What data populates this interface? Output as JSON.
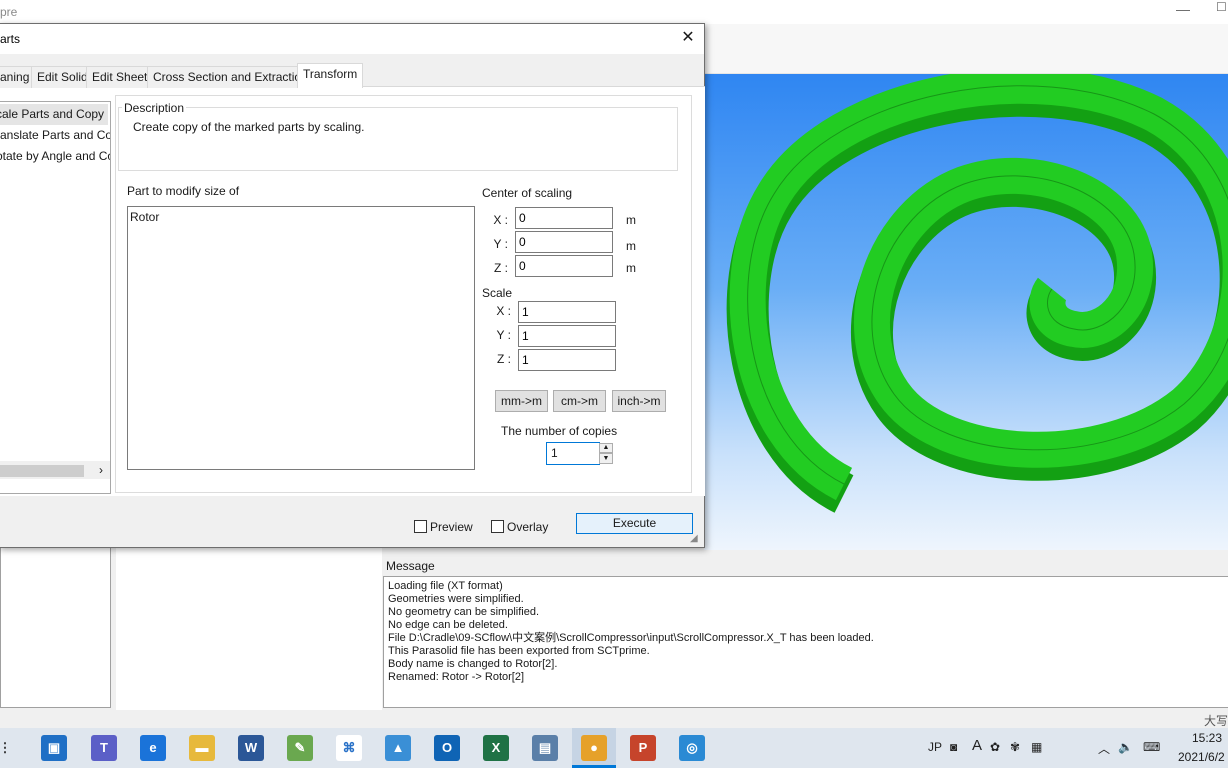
{
  "app": {
    "title": "pre",
    "status_text": "大写"
  },
  "dialog": {
    "title": "arts",
    "tabs": [
      {
        "label": "aning"
      },
      {
        "label": "Edit Solid"
      },
      {
        "label": "Edit Sheet"
      },
      {
        "label": "Cross Section and Extraction"
      },
      {
        "label": "Transform"
      }
    ],
    "active_tab": "Transform",
    "menu_items": [
      {
        "label": "cale Parts and Copy"
      },
      {
        "label": "ranslate Parts and Cop"
      },
      {
        "label": "otate by Angle and Co"
      }
    ],
    "description": {
      "legend": "Description",
      "text": "Create copy of the marked parts by scaling."
    },
    "parts": {
      "label": "Part to modify size of",
      "items": [
        "Rotor"
      ]
    },
    "center": {
      "label": "Center of scaling",
      "x_label": "X :",
      "y_label": "Y :",
      "z_label": "Z :",
      "x": "0",
      "y": "0",
      "z": "0",
      "unit": "m"
    },
    "scale": {
      "label": "Scale",
      "x_label": "X :",
      "y_label": "Y :",
      "z_label": "Z :",
      "x": "1",
      "y": "1",
      "z": "1"
    },
    "conversion_buttons": [
      "mm->m",
      "cm->m",
      "inch->m"
    ],
    "copies": {
      "label": "The number of copies",
      "value": "1"
    },
    "preview_label": "Preview",
    "overlay_label": "Overlay",
    "execute_label": "Execute"
  },
  "message": {
    "title": "Message",
    "lines": [
      "Loading file (XT format)",
      "Geometries were simplified.",
      "No geometry can be simplified.",
      "No edge can be deleted.",
      "File D:\\Cradle\\09-SCflow\\中文案例\\ScrollCompressor\\input\\ScrollCompressor.X_T has been loaded.",
      "This Parasolid file has been exported from SCTprime.",
      "Body name is changed to Rotor[2].",
      "Renamed: Rotor -> Rotor[2]"
    ]
  },
  "viewport": {
    "model_color": "#22cc22",
    "background_top": "#2f86f2"
  },
  "taskbar": {
    "tray_ime": "JP",
    "tray_ime_mode": "A",
    "clock_time": "15:23",
    "clock_date": "2021/6/2"
  }
}
